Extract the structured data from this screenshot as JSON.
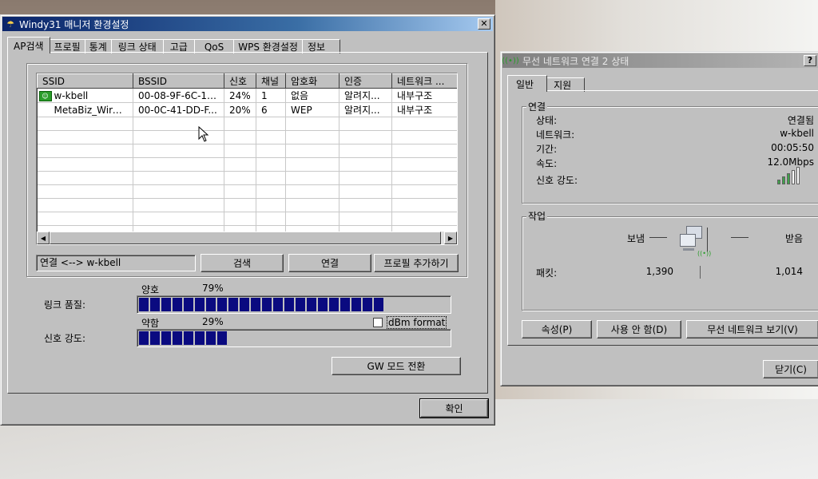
{
  "left_window": {
    "title": "Windy31 매니저 환경설정",
    "close_glyph": "✕",
    "tabs": [
      "AP검색",
      "프로필",
      "통계",
      "링크 상태",
      "고급",
      "QoS",
      "WPS 환경설정",
      "정보"
    ],
    "table": {
      "columns": [
        "SSID",
        "BSSID",
        "신호",
        "채널",
        "암호화",
        "인증",
        "네트워크 ..."
      ],
      "rows": [
        [
          "w-kbell",
          "00-08-9F-6C-11...",
          "24%",
          "1",
          "없음",
          "알려지...",
          "내부구조"
        ],
        [
          "MetaBiz_Wirel...",
          "00-0C-41-DD-F...",
          "20%",
          "6",
          "WEP",
          "알려지...",
          "내부구조"
        ]
      ]
    },
    "connection_status": "연결 <--> w-kbell",
    "buttons": {
      "search": "검색",
      "connect": "연결",
      "add_profile": "프로필 추가하기",
      "gw_mode": "GW 모드 전환",
      "ok": "확인"
    },
    "link_quality": {
      "label": "링크 품질:",
      "level_text": "양호",
      "percent_text": "79%",
      "percent": 79
    },
    "signal_strength": {
      "label": "신호 강도:",
      "level_text": "약함",
      "percent_text": "29%",
      "percent": 29
    },
    "dbm_format": {
      "label": "dBm format",
      "checked": false
    }
  },
  "right_window": {
    "title": "무선 네트워크 연결 2 상태",
    "help_glyph": "?",
    "tabs": [
      "일반",
      "지원"
    ],
    "connection": {
      "group_label": "연결",
      "fields": [
        {
          "label": "상태:",
          "value": "연결됨"
        },
        {
          "label": "네트워크:",
          "value": "w-kbell"
        },
        {
          "label": "기간:",
          "value": "00:05:50"
        },
        {
          "label": "속도:",
          "value": "12.0Mbps"
        }
      ],
      "signal_label": "신호 강도:",
      "signal_bars_lit": 3,
      "signal_bars_total": 5
    },
    "activity": {
      "group_label": "작업",
      "sent_label": "보냄",
      "received_label": "받음",
      "packets_label": "패킷:",
      "sent_packets": "1,390",
      "received_packets": "1,014"
    },
    "buttons": {
      "properties": "속성(P)",
      "disable": "사용 안 함(D)",
      "view_networks": "무선 네트워크 보기(V)",
      "close": "닫기(C)"
    }
  },
  "colors": {
    "title_active": "#0a246a",
    "title_inactive": "#808080",
    "progress": "#0a0a80",
    "face": "#c0c0c0"
  }
}
